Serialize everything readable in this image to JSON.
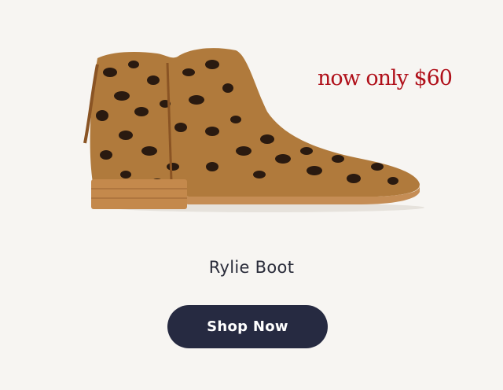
{
  "promo": {
    "price_text": "now only $60"
  },
  "product": {
    "image_icon": "leopard-print-ankle-boot",
    "name": "Rylie Boot"
  },
  "cta": {
    "label": "Shop Now"
  },
  "colors": {
    "background": "#f7f5f2",
    "price": "#b0101a",
    "button_bg": "#262a41",
    "button_text": "#ffffff",
    "name_text": "#2a2c3a"
  }
}
